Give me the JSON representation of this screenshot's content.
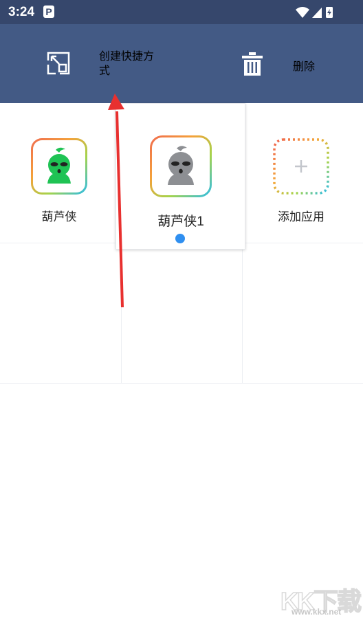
{
  "status_bar": {
    "time": "3:24",
    "notification_icon": "p-icon",
    "icons": [
      "wifi-icon",
      "cellular-signal-icon",
      "battery-charging-icon"
    ]
  },
  "action_bar": {
    "create_shortcut_label": "创建快捷方式",
    "create_shortcut_icon": "create-shortcut-icon",
    "delete_label": "删除",
    "delete_icon": "trash-icon"
  },
  "apps": [
    {
      "label": "葫芦侠",
      "icon": "huluxia-green-icon"
    },
    {
      "label": "葫芦侠1",
      "icon": "huluxia-gray-icon",
      "selected": true
    },
    {
      "label": "添加应用",
      "icon": "add-app-icon"
    }
  ],
  "colors": {
    "status_bar": "#36476c",
    "action_bar": "#435a85",
    "selection_dot": "#2f8ff0",
    "annotation_arrow": "#e8302f"
  },
  "watermark": {
    "logo": "KK下载",
    "url": "www.kkx.net"
  }
}
